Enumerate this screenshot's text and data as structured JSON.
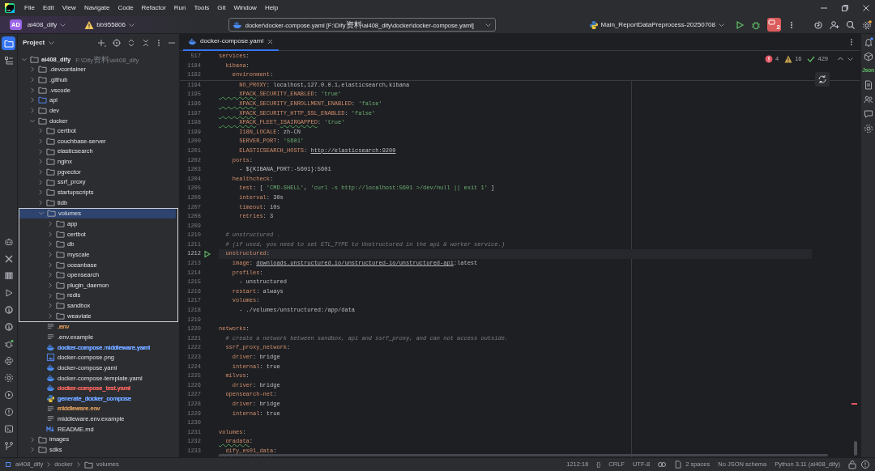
{
  "menu": [
    "File",
    "Edit",
    "View",
    "Navigate",
    "Code",
    "Refactor",
    "Run",
    "Tools",
    "Git",
    "Window",
    "Help"
  ],
  "toolbar": {
    "project_badge": "AD",
    "project": "ai408_dify",
    "branch": "bb955806",
    "search": {
      "value": "docker\\docker-compose.yaml [F:\\Dify资料\\ai408_dify\\docker\\docker-compose.yaml]"
    },
    "run_config": "Main_ReportDataPreprocess-20250708",
    "stop_count": "2",
    "settings_badge": true
  },
  "left_strip": {
    "top": [
      {
        "kind": "project",
        "selected": true
      },
      {
        "kind": "structure",
        "selected": false
      }
    ],
    "bottom": [
      {
        "kind": "robot",
        "selected": false
      },
      {
        "kind": "tools",
        "selected": false
      },
      {
        "kind": "columns",
        "selected": false
      },
      {
        "kind": "run",
        "selected": false
      },
      {
        "kind": "ring",
        "selected": false
      },
      {
        "kind": "ring",
        "selected": false
      },
      {
        "kind": "debug",
        "selected": false
      },
      {
        "kind": "python",
        "selected": false
      },
      {
        "kind": "packages",
        "selected": false
      },
      {
        "kind": "services",
        "selected": false
      },
      {
        "kind": "problems",
        "selected": false
      },
      {
        "kind": "terminal",
        "selected": false
      },
      {
        "kind": "git",
        "selected": false
      }
    ]
  },
  "project_panel": {
    "title": "Project",
    "tree": [
      {
        "label": "ai408_dify",
        "path": "F:\\Dify资料\\ai408_dify",
        "kind": "folder",
        "expanded": true,
        "selected": false,
        "outlined": false,
        "children": [
          {
            "label": ".devcontainer",
            "kind": "folder",
            "expanded": false,
            "selected": false,
            "outlined": false
          },
          {
            "label": ".github",
            "kind": "folder",
            "expanded": false,
            "selected": false,
            "outlined": false
          },
          {
            "label": ".vscode",
            "kind": "folder",
            "expanded": false,
            "selected": false,
            "outlined": false
          },
          {
            "label": "api",
            "kind": "source_folder",
            "expanded": false,
            "selected": false,
            "outlined": false
          },
          {
            "label": "dev",
            "kind": "folder",
            "expanded": false,
            "selected": false,
            "outlined": false
          },
          {
            "label": "docker",
            "kind": "folder",
            "expanded": true,
            "selected": false,
            "outlined": false,
            "children": [
              {
                "label": "certbot",
                "kind": "folder",
                "expanded": false,
                "selected": false,
                "outlined": false
              },
              {
                "label": "couchbase-server",
                "kind": "folder",
                "expanded": false,
                "selected": false,
                "outlined": false
              },
              {
                "label": "elasticsearch",
                "kind": "folder",
                "expanded": false,
                "selected": false,
                "outlined": false
              },
              {
                "label": "nginx",
                "kind": "folder",
                "expanded": false,
                "selected": false,
                "outlined": false
              },
              {
                "label": "pgvector",
                "kind": "folder",
                "expanded": false,
                "selected": false,
                "outlined": false
              },
              {
                "label": "ssrf_proxy",
                "kind": "folder",
                "expanded": false,
                "selected": false,
                "outlined": false
              },
              {
                "label": "startupscripts",
                "kind": "folder",
                "expanded": false,
                "selected": false,
                "outlined": false
              },
              {
                "label": "tidb",
                "kind": "folder",
                "expanded": false,
                "selected": false,
                "outlined": false
              },
              {
                "label": "volumes",
                "kind": "folder",
                "expanded": true,
                "selected": true,
                "outlined": true,
                "children": [
                  {
                    "label": "app",
                    "kind": "folder",
                    "expanded": false,
                    "selected": false,
                    "outlined": false
                  },
                  {
                    "label": "certbot",
                    "kind": "folder",
                    "expanded": false,
                    "selected": false,
                    "outlined": false
                  },
                  {
                    "label": "db",
                    "kind": "folder",
                    "expanded": false,
                    "selected": false,
                    "outlined": false
                  },
                  {
                    "label": "myscale",
                    "kind": "folder",
                    "expanded": false,
                    "selected": false,
                    "outlined": false
                  },
                  {
                    "label": "oceanbase",
                    "kind": "folder",
                    "expanded": false,
                    "selected": false,
                    "outlined": false
                  },
                  {
                    "label": "opensearch",
                    "kind": "folder",
                    "expanded": false,
                    "selected": false,
                    "outlined": false
                  },
                  {
                    "label": "plugin_daemon",
                    "kind": "folder",
                    "expanded": false,
                    "selected": false,
                    "outlined": false
                  },
                  {
                    "label": "redis",
                    "kind": "folder",
                    "expanded": false,
                    "selected": false,
                    "outlined": false
                  },
                  {
                    "label": "sandbox",
                    "kind": "folder",
                    "expanded": false,
                    "selected": false,
                    "outlined": false
                  },
                  {
                    "label": "weaviate",
                    "kind": "folder",
                    "expanded": false,
                    "selected": false,
                    "outlined": false
                  }
                ]
              },
              {
                "label": ".env",
                "kind": "text",
                "selected": false,
                "outlined": false,
                "color": "#c08a55"
              },
              {
                "label": ".env.example",
                "kind": "text",
                "selected": false,
                "outlined": false
              },
              {
                "label": "docker-compose.middleware.yaml",
                "kind": "docker",
                "selected": false,
                "outlined": false,
                "color": "#6c9ef8"
              },
              {
                "label": "docker-compose.png",
                "kind": "image",
                "selected": false,
                "outlined": false
              },
              {
                "label": "docker-compose.yaml",
                "kind": "docker",
                "selected": false,
                "outlined": false
              },
              {
                "label": "docker-compose-template.yaml",
                "kind": "docker",
                "selected": false,
                "outlined": false
              },
              {
                "label": "docker-compose_test.yaml",
                "kind": "docker",
                "selected": false,
                "outlined": false,
                "color": "#e0605b"
              },
              {
                "label": "generate_docker_compose",
                "kind": "python",
                "selected": false,
                "outlined": false,
                "color": "#6c9ef8"
              },
              {
                "label": "middleware.env",
                "kind": "text",
                "selected": false,
                "outlined": false,
                "color": "#c08a55"
              },
              {
                "label": "middleware.env.example",
                "kind": "text",
                "selected": false,
                "outlined": false
              },
              {
                "label": "README.md",
                "kind": "markdown",
                "selected": false,
                "outlined": false
              }
            ]
          },
          {
            "label": "images",
            "kind": "folder",
            "expanded": false,
            "selected": false,
            "outlined": false
          },
          {
            "label": "sdks",
            "kind": "folder",
            "expanded": false,
            "selected": false,
            "outlined": false
          }
        ]
      }
    ]
  },
  "editor": {
    "tabs": [
      {
        "label": "docker-compose.yaml",
        "selected": true
      }
    ],
    "inspections": {
      "errors": "4",
      "warnings": "16",
      "ok": "429"
    },
    "sticky_lines": [
      {
        "n": "517",
        "current": false,
        "tokens": [
          {
            "kind": "key",
            "text": "services"
          },
          {
            "kind": "plain",
            "text": ":"
          }
        ]
      },
      {
        "n": "1184",
        "current": false,
        "tokens": [
          {
            "kind": "key",
            "text": "  kibana"
          },
          {
            "kind": "plain",
            "text": ":"
          }
        ]
      },
      {
        "n": "1192",
        "current": false,
        "tokens": [
          {
            "kind": "key",
            "text": "    environment"
          },
          {
            "kind": "plain",
            "text": ":"
          }
        ]
      }
    ],
    "lines": [
      {
        "n": "1194",
        "current": false,
        "tokens": [
          {
            "kind": "key",
            "text": "      NO_PROXY"
          },
          {
            "kind": "plain",
            "text": ": localhost,127.0.0.1,elasticsearch,kibana"
          }
        ]
      },
      {
        "n": "1195",
        "current": false,
        "tokens": [
          {
            "kind": "typo",
            "text": "      XPACK"
          },
          {
            "kind": "key",
            "text": "_SECURITY_ENABLED"
          },
          {
            "kind": "plain",
            "text": ": "
          },
          {
            "kind": "string",
            "text": "'true'"
          }
        ]
      },
      {
        "n": "1196",
        "current": false,
        "tokens": [
          {
            "kind": "typo",
            "text": "      XPACK"
          },
          {
            "kind": "key",
            "text": "_SECURITY_ENROLLMENT_ENABLED"
          },
          {
            "kind": "plain",
            "text": ": "
          },
          {
            "kind": "string",
            "text": "'false'"
          }
        ]
      },
      {
        "n": "1197",
        "current": false,
        "tokens": [
          {
            "kind": "typo",
            "text": "      XPACK"
          },
          {
            "kind": "key",
            "text": "_SECURITY_HTTP_SSL_ENABLED"
          },
          {
            "kind": "plain",
            "text": ": "
          },
          {
            "kind": "string",
            "text": "'false'"
          }
        ]
      },
      {
        "n": "1198",
        "current": false,
        "tokens": [
          {
            "kind": "typo",
            "text": "      XPACK"
          },
          {
            "kind": "key",
            "text": "_FLEET_"
          },
          {
            "kind": "typo",
            "text": "ISAIRGAPPED"
          },
          {
            "kind": "plain",
            "text": ": "
          },
          {
            "kind": "string",
            "text": "'true'"
          }
        ]
      },
      {
        "n": "1199",
        "current": false,
        "tokens": [
          {
            "kind": "key",
            "text": "      I18N_LOCALE"
          },
          {
            "kind": "plain",
            "text": ": zh-CN"
          }
        ]
      },
      {
        "n": "1200",
        "current": false,
        "tokens": [
          {
            "kind": "key",
            "text": "      SERVER_PORT"
          },
          {
            "kind": "plain",
            "text": ": "
          },
          {
            "kind": "string",
            "text": "'5601'"
          }
        ]
      },
      {
        "n": "1201",
        "current": false,
        "tokens": [
          {
            "kind": "key",
            "text": "      ELASTICSEARCH_HOSTS"
          },
          {
            "kind": "plain",
            "text": ": "
          },
          {
            "kind": "link",
            "text": "http://elasticsearch:9200"
          }
        ]
      },
      {
        "n": "1202",
        "current": false,
        "tokens": [
          {
            "kind": "key",
            "text": "    ports"
          },
          {
            "kind": "plain",
            "text": ":"
          }
        ]
      },
      {
        "n": "1203",
        "current": false,
        "tokens": [
          {
            "kind": "plain",
            "text": "      - ${KIBANA_PORT:-5601}:5601"
          }
        ]
      },
      {
        "n": "1204",
        "current": false,
        "tokens": [
          {
            "kind": "key",
            "text": "    healthcheck"
          },
          {
            "kind": "plain",
            "text": ":"
          }
        ]
      },
      {
        "n": "1205",
        "current": false,
        "tokens": [
          {
            "kind": "key",
            "text": "      test"
          },
          {
            "kind": "plain",
            "text": ": [ "
          },
          {
            "kind": "string",
            "text": "'CMD-SHELL'"
          },
          {
            "kind": "plain",
            "text": ", "
          },
          {
            "kind": "string",
            "text": "'curl -s http://localhost:5601 >/dev/null || exit 1'"
          },
          {
            "kind": "plain",
            "text": " ]"
          }
        ]
      },
      {
        "n": "1206",
        "current": false,
        "tokens": [
          {
            "kind": "key",
            "text": "      interval"
          },
          {
            "kind": "plain",
            "text": ": 30s"
          }
        ]
      },
      {
        "n": "1207",
        "current": false,
        "tokens": [
          {
            "kind": "key",
            "text": "      timeout"
          },
          {
            "kind": "plain",
            "text": ": 10s"
          }
        ]
      },
      {
        "n": "1208",
        "current": false,
        "tokens": [
          {
            "kind": "key",
            "text": "      retries"
          },
          {
            "kind": "plain",
            "text": ": 3"
          }
        ]
      },
      {
        "n": "1209",
        "current": false
      },
      {
        "n": "1210",
        "current": false,
        "tokens": [
          {
            "kind": "comment",
            "text": "  # unstructured ."
          }
        ]
      },
      {
        "n": "1211",
        "current": false,
        "tokens": [
          {
            "kind": "comment",
            "text": "  # (if used, you need to set ETL_TYPE to Unstructured in the api & worker service.)"
          }
        ]
      },
      {
        "n": "1212",
        "current": true,
        "runnable": true,
        "tokens": [
          {
            "kind": "key",
            "text": "  unstructured"
          },
          {
            "kind": "plain",
            "text": ":"
          }
        ]
      },
      {
        "n": "1213",
        "current": false,
        "tokens": [
          {
            "kind": "key",
            "text": "    image"
          },
          {
            "kind": "plain",
            "text": ": "
          },
          {
            "kind": "link",
            "text": "downloads.unstructured.io/unstructured-io/unstructured-api"
          },
          {
            "kind": "plain",
            "text": ":latest"
          }
        ]
      },
      {
        "n": "1214",
        "current": false,
        "tokens": [
          {
            "kind": "key",
            "text": "    profiles"
          },
          {
            "kind": "plain",
            "text": ":"
          }
        ]
      },
      {
        "n": "1215",
        "current": false,
        "tokens": [
          {
            "kind": "plain",
            "text": "      - unstructured"
          }
        ]
      },
      {
        "n": "1216",
        "current": false,
        "tokens": [
          {
            "kind": "key",
            "text": "    restart"
          },
          {
            "kind": "plain",
            "text": ": always"
          }
        ]
      },
      {
        "n": "1217",
        "current": false,
        "tokens": [
          {
            "kind": "key",
            "text": "    volumes"
          },
          {
            "kind": "plain",
            "text": ":"
          }
        ]
      },
      {
        "n": "1218",
        "current": false,
        "tokens": [
          {
            "kind": "plain",
            "text": "      - ./volumes/unstructured:/app/data"
          }
        ]
      },
      {
        "n": "1219",
        "current": false
      },
      {
        "n": "1220",
        "current": false,
        "tokens": [
          {
            "kind": "key",
            "text": "networks"
          },
          {
            "kind": "plain",
            "text": ":"
          }
        ]
      },
      {
        "n": "1221",
        "current": false,
        "tokens": [
          {
            "kind": "comment",
            "text": "  # create a network between sandbox, api and ssrf_proxy, and can not access outside."
          }
        ]
      },
      {
        "n": "1222",
        "current": false,
        "tokens": [
          {
            "kind": "key",
            "text": "  ssrf_proxy_network"
          },
          {
            "kind": "plain",
            "text": ":"
          }
        ]
      },
      {
        "n": "1223",
        "current": false,
        "tokens": [
          {
            "kind": "key",
            "text": "    driver"
          },
          {
            "kind": "plain",
            "text": ": bridge"
          }
        ]
      },
      {
        "n": "1224",
        "current": false,
        "tokens": [
          {
            "kind": "key",
            "text": "    internal"
          },
          {
            "kind": "plain",
            "text": ": true"
          }
        ]
      },
      {
        "n": "1225",
        "current": false,
        "tokens": [
          {
            "kind": "key",
            "text": "  milvus"
          },
          {
            "kind": "plain",
            "text": ":"
          }
        ]
      },
      {
        "n": "1226",
        "current": false,
        "tokens": [
          {
            "kind": "key",
            "text": "    driver"
          },
          {
            "kind": "plain",
            "text": ": bridge"
          }
        ]
      },
      {
        "n": "1227",
        "current": false,
        "tokens": [
          {
            "kind": "key",
            "text": "  opensearch-net"
          },
          {
            "kind": "plain",
            "text": ":"
          }
        ]
      },
      {
        "n": "1228",
        "current": false,
        "tokens": [
          {
            "kind": "key",
            "text": "    driver"
          },
          {
            "kind": "plain",
            "text": ": bridge"
          }
        ]
      },
      {
        "n": "1229",
        "current": false,
        "tokens": [
          {
            "kind": "key",
            "text": "    internal"
          },
          {
            "kind": "plain",
            "text": ": true"
          }
        ]
      },
      {
        "n": "1230",
        "current": false
      },
      {
        "n": "1231",
        "current": false,
        "tokens": [
          {
            "kind": "key",
            "text": "volumes"
          },
          {
            "kind": "plain",
            "text": ":"
          }
        ]
      },
      {
        "n": "1232",
        "current": false,
        "tokens": [
          {
            "kind": "typo",
            "text": "  oradata"
          },
          {
            "kind": "plain",
            "text": ":"
          }
        ]
      },
      {
        "n": "1233",
        "current": false,
        "tokens": [
          {
            "kind": "typo",
            "text": "  dify_es01_data"
          },
          {
            "kind": "plain",
            "text": ":"
          }
        ]
      }
    ]
  },
  "right_strip": [
    {
      "kind": "notifications",
      "unread": true
    },
    {
      "kind": "cube"
    },
    {
      "kind": "label",
      "text": "Json"
    },
    {
      "kind": "document"
    },
    {
      "kind": "people"
    },
    {
      "kind": "chat"
    },
    {
      "kind": "gear"
    }
  ],
  "status_bar": {
    "breadcrumbs": [
      {
        "label": "ai408_dify",
        "kind": "module"
      },
      {
        "label": "docker",
        "kind": "plain"
      },
      {
        "label": "volumes",
        "kind": "folder"
      }
    ],
    "position": "1212:16",
    "format_icon": "{}",
    "line_separator": "CRLF",
    "encoding": "UTF-8",
    "indent": "2 spaces",
    "schema": "No JSON schema",
    "interpreter": "Python 3.11 (ai408_dify)"
  }
}
